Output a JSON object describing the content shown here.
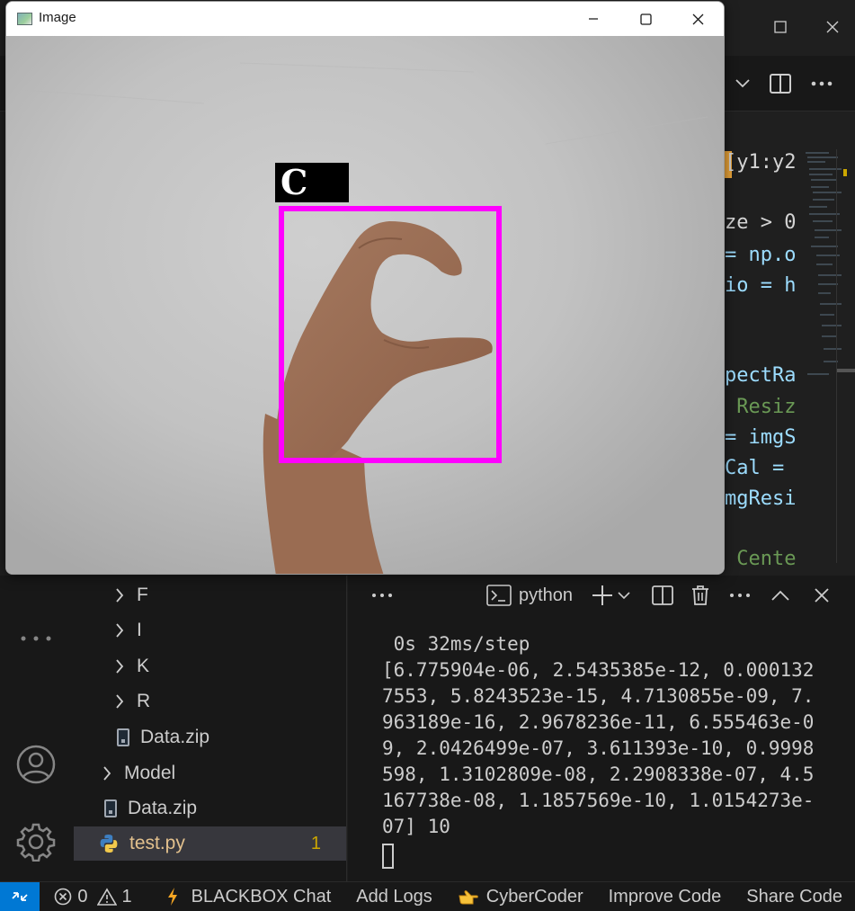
{
  "image_window": {
    "title": "Image",
    "prediction_label": "C"
  },
  "editor": {
    "code_fragments": [
      {
        "text": "[y1:y2",
        "color": "#d4d4d4"
      },
      {
        "text": "ze > 0",
        "color": "#d4d4d4"
      },
      {
        "text": "= np.o",
        "color": "#9cdcfe"
      },
      {
        "text": "io = h",
        "color": "#9cdcfe"
      },
      {
        "text": "pectRa",
        "color": "#9cdcfe"
      },
      {
        "text": " Resiz",
        "color": "#6a9955"
      },
      {
        "text": "= imgS",
        "color": "#9cdcfe"
      },
      {
        "text": "Cal = ",
        "color": "#9cdcfe"
      },
      {
        "text": "mgResi",
        "color": "#9cdcfe"
      },
      {
        "text": " Cente",
        "color": "#6a9955"
      }
    ]
  },
  "explorer": {
    "items": [
      {
        "label": "F",
        "kind": "folder"
      },
      {
        "label": "I",
        "kind": "folder"
      },
      {
        "label": "K",
        "kind": "folder"
      },
      {
        "label": "R",
        "kind": "folder"
      },
      {
        "label": "Data.zip",
        "kind": "zip"
      },
      {
        "label": "Model",
        "kind": "folder"
      },
      {
        "label": "Data.zip",
        "kind": "zip"
      },
      {
        "label": "test.py",
        "kind": "python",
        "problems": "1"
      }
    ]
  },
  "panel": {
    "terminal_name": "python",
    "output_lines": [
      " 0s 32ms/step",
      "[6.775904e-06, 2.5435385e-12, 0.000132",
      "7553, 5.8243523e-15, 4.7130855e-09, 7.",
      "963189e-16, 2.9678236e-11, 6.555463e-0",
      "9, 2.0426499e-07, 3.611393e-10, 0.9998",
      "598, 1.3102809e-08, 2.2908338e-07, 4.5",
      "167738e-08, 1.1857569e-10, 1.0154273e-",
      "07] 10"
    ]
  },
  "statusbar": {
    "errors": "0",
    "warnings": "1",
    "items": [
      "BLACKBOX Chat",
      "Add Logs",
      "CyberCoder",
      "Improve Code",
      "Share Code"
    ]
  },
  "colors": {
    "bbox": "#ff00ff",
    "remote_button": "#0078d4",
    "python_file": "#e2c08d"
  }
}
